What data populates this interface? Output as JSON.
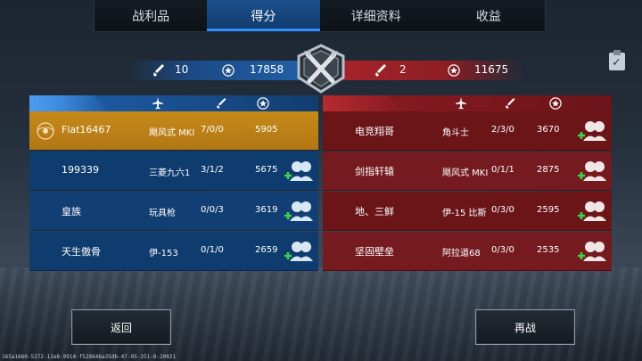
{
  "tabs": [
    {
      "label": "战利品",
      "active": false
    },
    {
      "label": "得分",
      "active": true
    },
    {
      "label": "详细资料",
      "active": false
    },
    {
      "label": "收益",
      "active": false
    }
  ],
  "scoreboard": {
    "blue_kills": "10",
    "blue_score": "17858",
    "red_kills": "2",
    "red_score": "11675"
  },
  "blue_team": [
    {
      "name": "Flat16467",
      "plane": "飓风式 MKⅠ",
      "kda": "7/0/0",
      "score": "5905",
      "self": true
    },
    {
      "name": "199339",
      "plane": "三菱九六1",
      "kda": "3/1/2",
      "score": "5675",
      "self": false
    },
    {
      "name": "皇族",
      "plane": "玩具枪",
      "kda": "0/0/3",
      "score": "3619",
      "self": false
    },
    {
      "name": "天生傲骨",
      "plane": "伊-153",
      "kda": "0/1/0",
      "score": "2659",
      "self": false
    }
  ],
  "red_team": [
    {
      "name": "电竞翔哥",
      "plane": "角斗士",
      "kda": "2/3/0",
      "score": "3670"
    },
    {
      "name": "剑指轩辕",
      "plane": "飓风式 MKⅠ",
      "kda": "0/1/1",
      "score": "2875"
    },
    {
      "name": "地、三鲜",
      "plane": "伊-15 比斯",
      "kda": "0/3/0",
      "score": "2595"
    },
    {
      "name": "坚固壁垒",
      "plane": "阿拉道68",
      "kda": "0/3/0",
      "score": "2535"
    }
  ],
  "buttons": {
    "back": "返回",
    "rematch": "再战"
  },
  "footer_id": "165a1660-5372-11e8-9914-f528646a35db-47-95-251-8-20021",
  "colors": {
    "blue": "#1b4a86",
    "red": "#8d1d24",
    "self_row": "#c68a19",
    "tab_active": "#1c4f8c"
  },
  "icons": {
    "header_plane": "plane-icon",
    "header_kills": "sword-icon",
    "header_score": "star-badge-icon",
    "friend": "add-friend-icon"
  }
}
